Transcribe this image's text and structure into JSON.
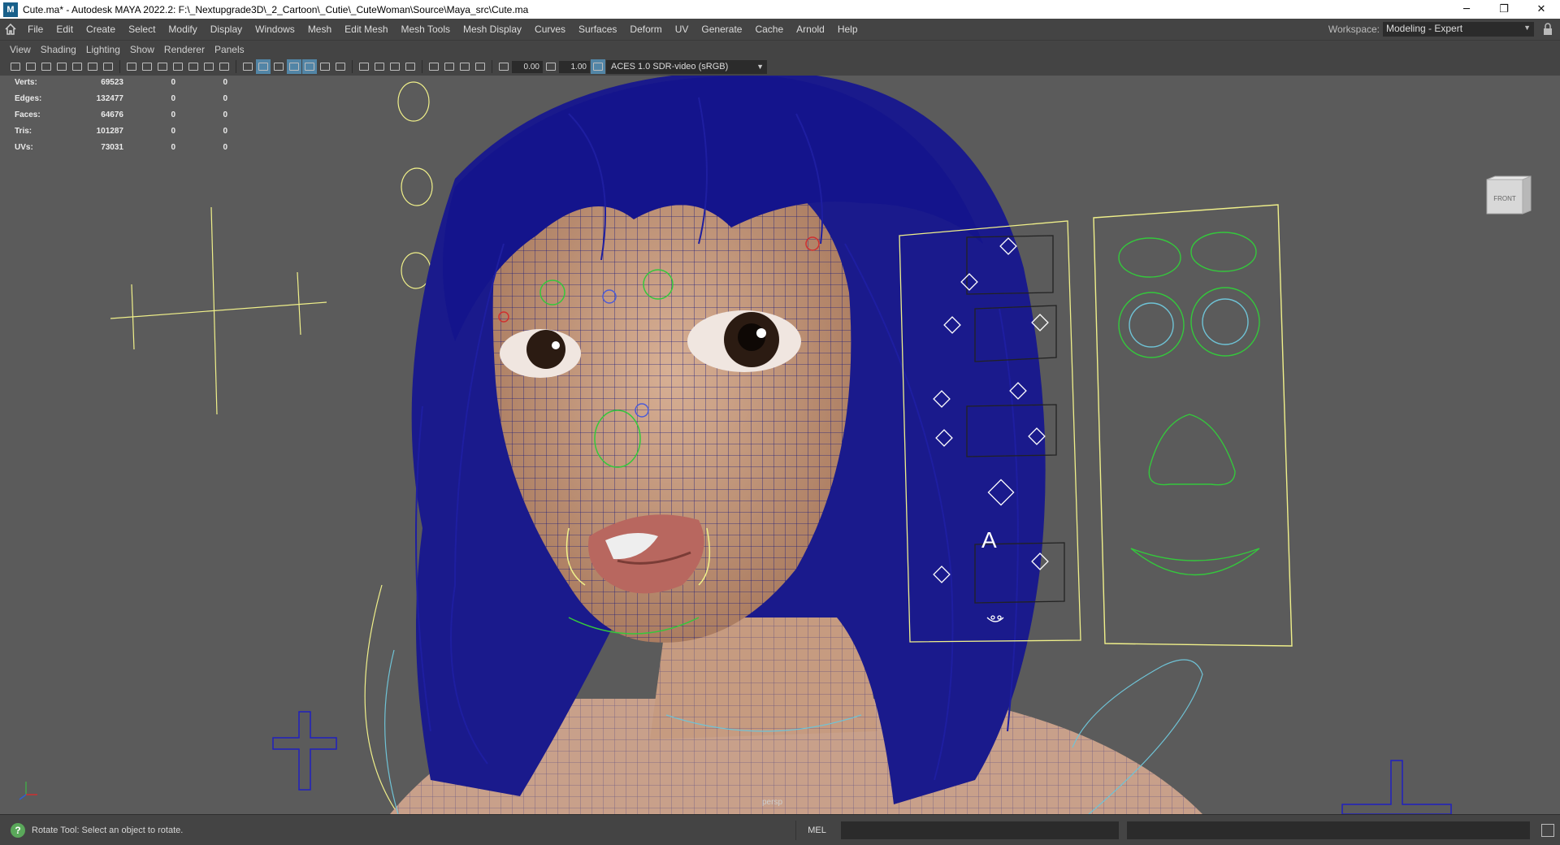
{
  "window": {
    "title": "Cute.ma* - Autodesk MAYA 2022.2: F:\\_Nextupgrade3D\\_2_Cartoon\\_Cutie\\_CuteWoman\\Source\\Maya_src\\Cute.ma",
    "app_icon_letter": "M",
    "minimize": "─",
    "maximize": "❐",
    "close": "✕"
  },
  "menubar": {
    "items": [
      "File",
      "Edit",
      "Create",
      "Select",
      "Modify",
      "Display",
      "Windows",
      "Mesh",
      "Edit Mesh",
      "Mesh Tools",
      "Mesh Display",
      "Curves",
      "Surfaces",
      "Deform",
      "UV",
      "Generate",
      "Cache",
      "Arnold",
      "Help"
    ],
    "workspace_label": "Workspace:",
    "workspace_value": "Modeling - Expert"
  },
  "panel_menu": {
    "items": [
      "View",
      "Shading",
      "Lighting",
      "Show",
      "Renderer",
      "Panels"
    ]
  },
  "viewport_toolbar": {
    "field_a": "0.00",
    "field_b": "1.00",
    "color_management": "ACES 1.0 SDR-video (sRGB)"
  },
  "hud": {
    "rows": [
      {
        "label": "Verts:",
        "v1": "69523",
        "v2": "0",
        "v3": "0"
      },
      {
        "label": "Edges:",
        "v1": "132477",
        "v2": "0",
        "v3": "0"
      },
      {
        "label": "Faces:",
        "v1": "64676",
        "v2": "0",
        "v3": "0"
      },
      {
        "label": "Tris:",
        "v1": "101287",
        "v2": "0",
        "v3": "0"
      },
      {
        "label": "UVs:",
        "v1": "73031",
        "v2": "0",
        "v3": "0"
      }
    ]
  },
  "viewcube": {
    "face": "FRONT"
  },
  "camera": {
    "name": "persp"
  },
  "rig_panel": {
    "letter": "A"
  },
  "command_line": {
    "status": "Rotate Tool: Select an object to rotate.",
    "language": "MEL"
  },
  "colors": {
    "viewport_bg": "#5b5b5b",
    "wire_blue": "#1a1a8a",
    "hair_blue": "#14148c",
    "control_yellow": "#f0f08a",
    "control_green": "#34c83c",
    "control_cyan": "#6fc3d6",
    "skin": "#c49a7c"
  }
}
